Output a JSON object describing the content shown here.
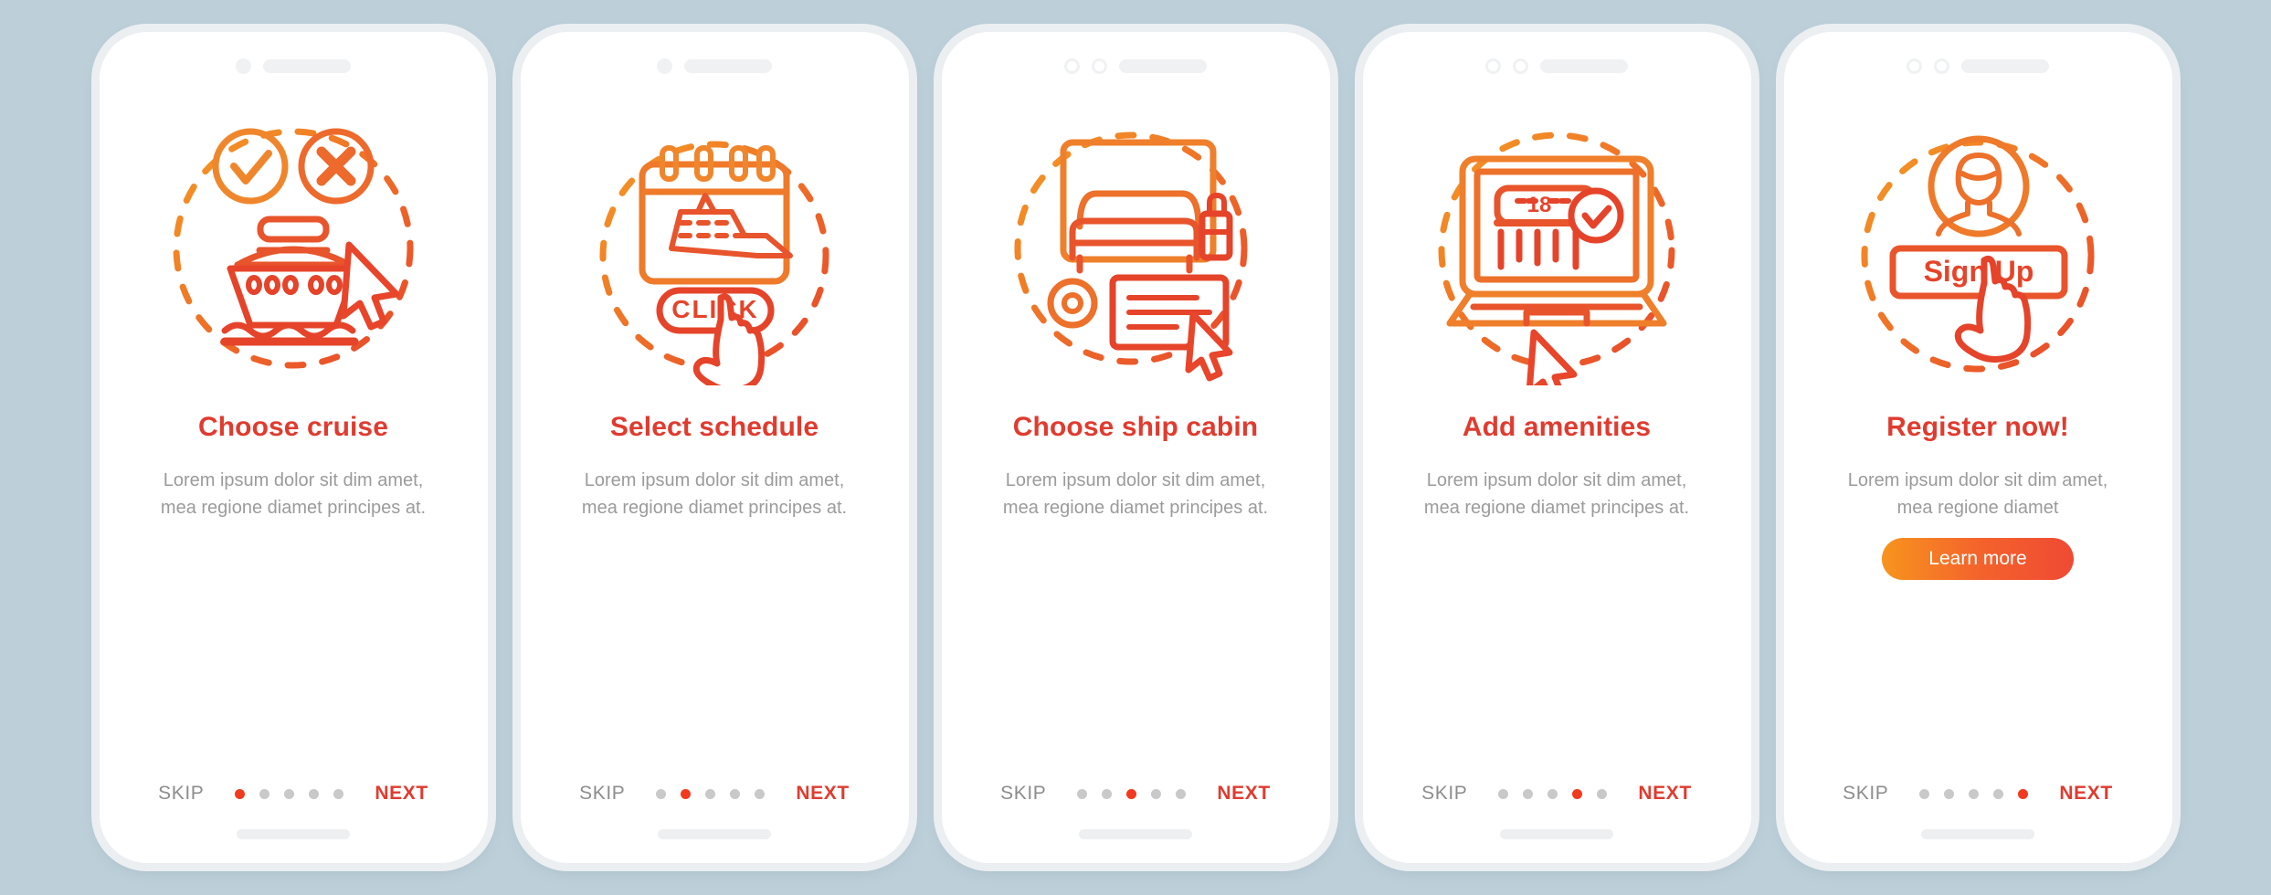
{
  "theme": {
    "background": "#bdd0da",
    "title_color": "#e03b2f",
    "body_color": "#9b9b9b",
    "accent_orange": "#f7941e",
    "accent_red": "#ef4a33",
    "active_dot": "#f23a1f",
    "inactive_dot": "#c9c9c9"
  },
  "nav_labels": {
    "skip": "SKIP",
    "next": "NEXT"
  },
  "total_steps": 5,
  "screens": [
    {
      "id": "choose-cruise",
      "title": "Choose cruise",
      "body": "Lorem ipsum dolor sit dim amet, mea regione diamet principes at.",
      "illustration": "cruise-ship-approve-reject-icon",
      "illustration_texts": [],
      "notch": "single-dot",
      "active_index": 0,
      "skip": "SKIP",
      "next": "NEXT",
      "cta": null
    },
    {
      "id": "select-schedule",
      "title": "Select schedule",
      "body": "Lorem ipsum dolor sit dim amet, mea regione diamet principes at.",
      "illustration": "calendar-cruise-click-icon",
      "illustration_texts": [
        "CLICK"
      ],
      "notch": "single-dot",
      "active_index": 1,
      "skip": "SKIP",
      "next": "NEXT",
      "cta": null
    },
    {
      "id": "choose-ship-cabin",
      "title": "Choose ship cabin",
      "body": "Lorem ipsum dolor sit dim amet, mea regione diamet principes at.",
      "illustration": "cabin-bed-booking-icon",
      "illustration_texts": [],
      "notch": "double-ring",
      "active_index": 2,
      "skip": "SKIP",
      "next": "NEXT",
      "cta": null
    },
    {
      "id": "add-amenities",
      "title": "Add amenities",
      "body": "Lorem ipsum dolor sit dim amet, mea regione diamet principes at.",
      "illustration": "laptop-amenities-checkmark-icon",
      "illustration_texts": [
        "18"
      ],
      "notch": "double-ring",
      "active_index": 3,
      "skip": "SKIP",
      "next": "NEXT",
      "cta": null
    },
    {
      "id": "register-now",
      "title": "Register now!",
      "body": "Lorem ipsum dolor sit dim amet, mea regione diamet",
      "illustration": "signup-avatar-hand-icon",
      "illustration_texts": [
        "Sign Up"
      ],
      "notch": "double-ring",
      "active_index": 4,
      "skip": "SKIP",
      "next": "NEXT",
      "cta": "Learn more"
    }
  ]
}
